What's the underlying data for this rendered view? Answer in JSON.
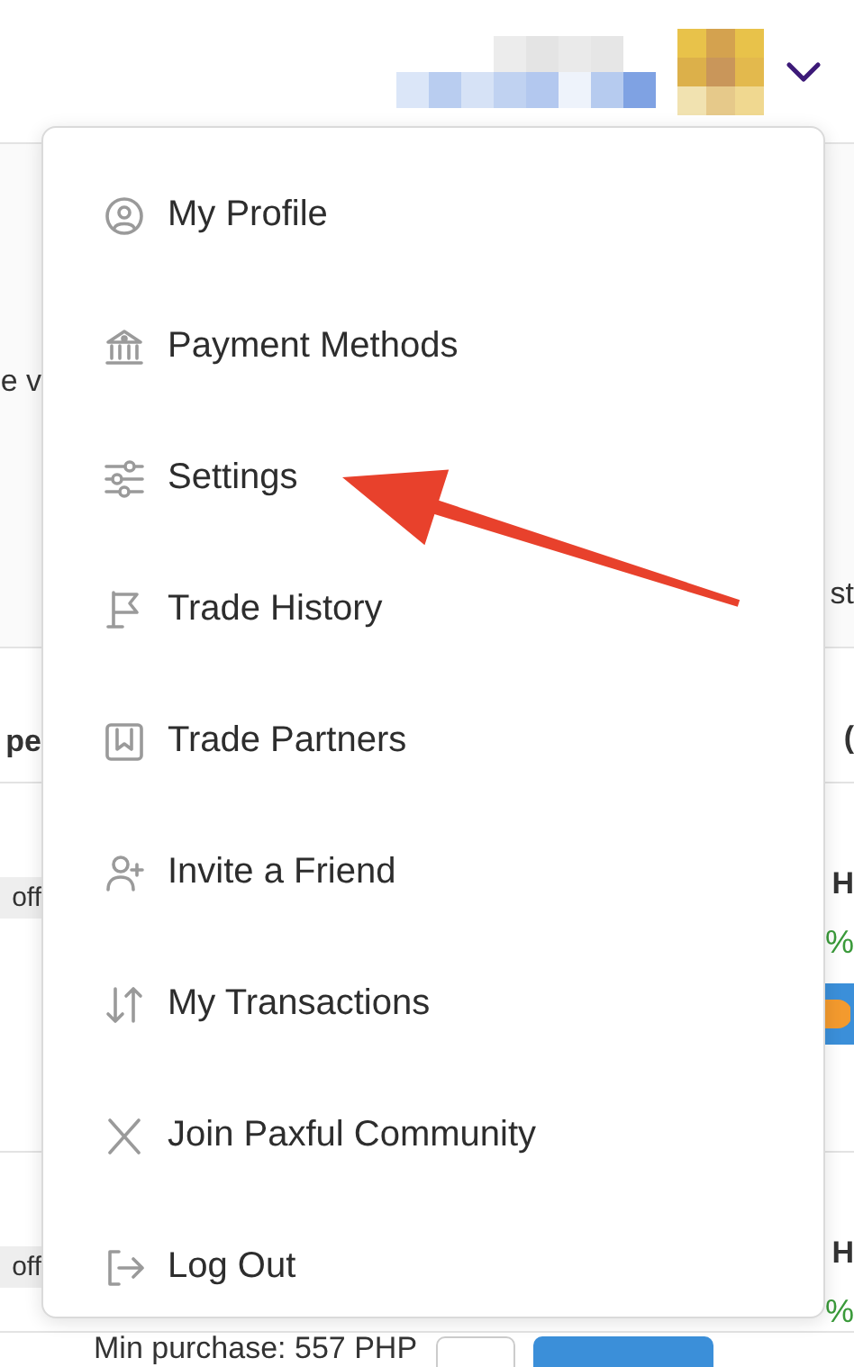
{
  "menu": {
    "items": [
      {
        "kind": "profile",
        "label": "My Profile"
      },
      {
        "kind": "bank",
        "label": "Payment Methods"
      },
      {
        "kind": "sliders",
        "label": "Settings"
      },
      {
        "kind": "flag",
        "label": "Trade History"
      },
      {
        "kind": "bookmark",
        "label": "Trade Partners"
      },
      {
        "kind": "invite",
        "label": "Invite a Friend"
      },
      {
        "kind": "transfer",
        "label": "My Transactions"
      },
      {
        "kind": "community",
        "label": "Join Paxful Community"
      },
      {
        "kind": "logout",
        "label": "Log Out"
      }
    ]
  },
  "background": {
    "rows": [
      {
        "kind": "plain",
        "left": "e v",
        "right": "st"
      },
      {
        "kind": "heading",
        "left": "pe",
        "right": "("
      },
      {
        "kind": "offer-coin",
        "left": "off",
        "right": "H",
        "rate": "%"
      },
      {
        "kind": "offer",
        "left": "off",
        "right": "H",
        "rate": "%"
      }
    ],
    "footer": "Min purchase: 557 PHP"
  }
}
